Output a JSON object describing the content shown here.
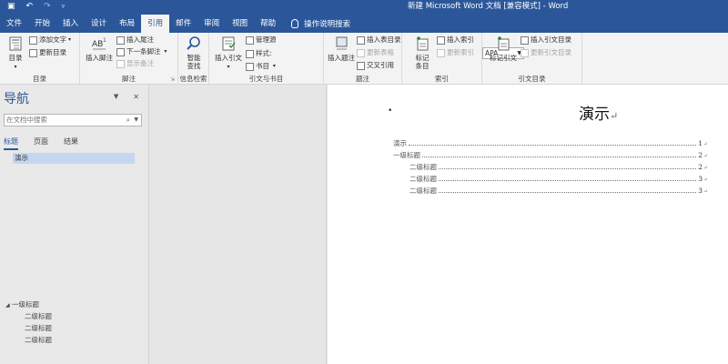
{
  "window": {
    "title": "新建 Microsoft Word 文档 [兼容模式] - Word",
    "qat": [
      "save-icon",
      "undo-icon",
      "redo-icon",
      "customize-icon"
    ]
  },
  "tabs": [
    {
      "label": "文件",
      "active": false
    },
    {
      "label": "开始",
      "active": false
    },
    {
      "label": "插入",
      "active": false
    },
    {
      "label": "设计",
      "active": false
    },
    {
      "label": "布局",
      "active": false
    },
    {
      "label": "引用",
      "active": true
    },
    {
      "label": "邮件",
      "active": false
    },
    {
      "label": "审阅",
      "active": false
    },
    {
      "label": "视图",
      "active": false
    },
    {
      "label": "帮助",
      "active": false
    }
  ],
  "tell_me": "操作说明搜索",
  "ribbon": {
    "toc_group": {
      "label": "目录",
      "big": "目录",
      "add_text": "添加文字",
      "update_toc": "更新目录"
    },
    "footnote_group": {
      "label": "脚注",
      "big": "插入脚注",
      "insert_endnote": "插入尾注",
      "next_footnote": "下一条脚注",
      "show_notes": "显示备注"
    },
    "research_group": {
      "label": "信息检索",
      "big_line1": "智能",
      "big_line2": "查找"
    },
    "citation_group": {
      "label": "引文与书目",
      "big": "插入引文",
      "manage_source": "管理源",
      "style_label": "样式:",
      "style_value": "APA",
      "bibliography": "书目"
    },
    "caption_group": {
      "label": "题注",
      "big": "插入题注",
      "insert_table_of_figures": "插入表目录",
      "update_table": "更新表格",
      "cross_reference": "交叉引用"
    },
    "index_group": {
      "label": "索引",
      "big_line1": "标记",
      "big_line2": "条目",
      "insert_index": "插入索引",
      "update_index": "更新索引"
    },
    "authorities_group": {
      "label": "引文目录",
      "big": "标记引文",
      "insert_toa": "插入引文目录",
      "update_toa": "更新引文目录"
    }
  },
  "nav_pane": {
    "title": "导航",
    "search_placeholder": "在文档中搜索",
    "tabs": [
      {
        "label": "标题",
        "active": true
      },
      {
        "label": "页面",
        "active": false
      },
      {
        "label": "结果",
        "active": false
      }
    ],
    "selected_heading": "演示",
    "tree": [
      {
        "label": "一级标题",
        "level": 1
      },
      {
        "label": "二级标题",
        "level": 2
      },
      {
        "label": "二级标题",
        "level": 2
      },
      {
        "label": "二级标题",
        "level": 2
      }
    ]
  },
  "document": {
    "title": "演示",
    "toc": [
      {
        "text": "演示",
        "page": "1",
        "level": 0
      },
      {
        "text": "一级标题",
        "page": "2",
        "level": 1
      },
      {
        "text": "二级标题",
        "page": "2",
        "level": 2
      },
      {
        "text": "二级标题",
        "page": "3",
        "level": 2
      },
      {
        "text": "二级标题",
        "page": "3",
        "level": 2
      }
    ]
  },
  "colors": {
    "brand": "#2b579a",
    "selection": "#c5d7f0",
    "ribbon_bg": "#f3f3f3"
  }
}
